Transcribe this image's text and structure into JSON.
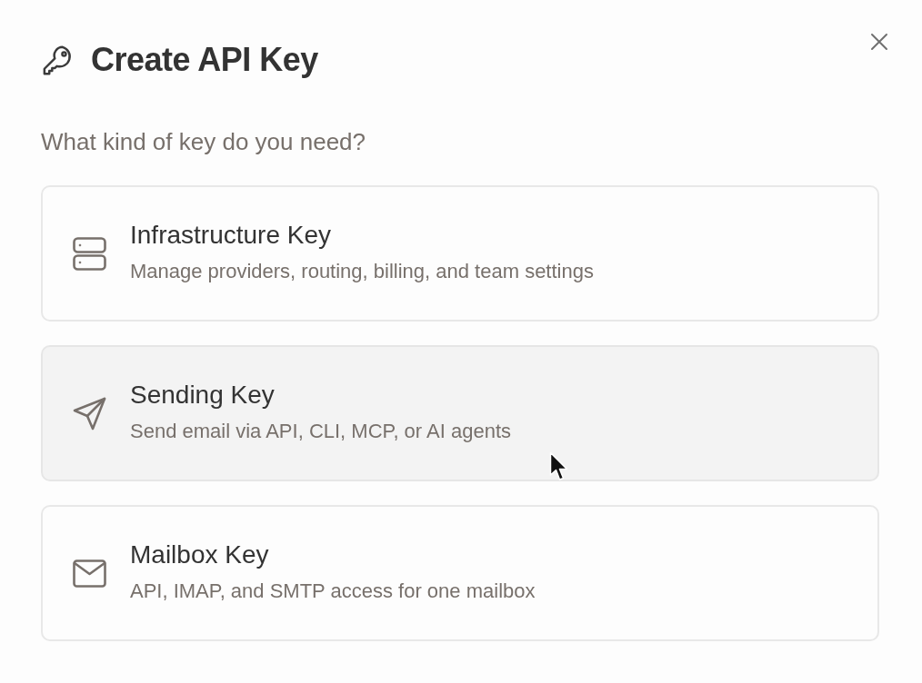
{
  "dialog": {
    "title": "Create API Key",
    "prompt": "What kind of key do you need?"
  },
  "options": [
    {
      "kind": "infrastructure",
      "title": "Infrastructure Key",
      "description": "Manage providers, routing, billing, and team settings",
      "hovered": false
    },
    {
      "kind": "sending",
      "title": "Sending Key",
      "description": "Send email via API, CLI, MCP, or AI agents",
      "hovered": true
    },
    {
      "kind": "mailbox",
      "title": "Mailbox Key",
      "description": "API, IMAP, and SMTP access for one mailbox",
      "hovered": false
    }
  ]
}
